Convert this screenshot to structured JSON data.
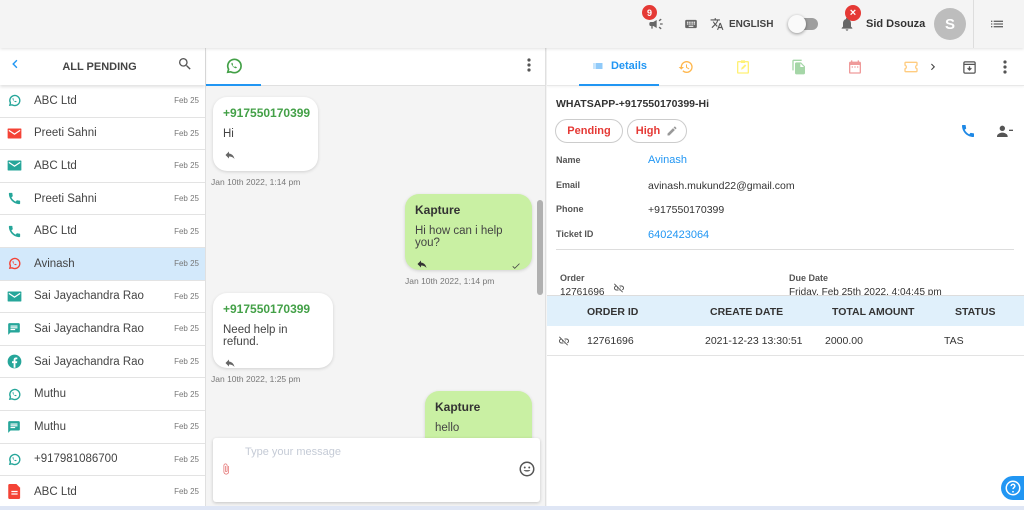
{
  "topbar": {
    "announcement_badge": "9",
    "language": "ENGLISH",
    "toggle_on": false,
    "notification_badge": "×",
    "user_name": "Sid Dsouza",
    "avatar_initial": "S"
  },
  "left_panel": {
    "title": "ALL PENDING",
    "items": [
      {
        "channel": "whatsapp",
        "name": "ABC Ltd",
        "date": "Feb 25",
        "icon_color": "#26a69a"
      },
      {
        "channel": "email",
        "name": "Preeti Sahni",
        "date": "Feb 25",
        "icon_color": "#f44336"
      },
      {
        "channel": "email",
        "name": "ABC Ltd",
        "date": "Feb 25",
        "icon_color": "#26a69a"
      },
      {
        "channel": "phone",
        "name": "Preeti Sahni",
        "date": "Feb 25",
        "icon_color": "#26a69a"
      },
      {
        "channel": "phone",
        "name": "ABC Ltd",
        "date": "Feb 25",
        "icon_color": "#26a69a"
      },
      {
        "channel": "whatsapp",
        "name": "Avinash",
        "date": "Feb 25",
        "icon_color": "#f44336",
        "active": true
      },
      {
        "channel": "email",
        "name": "Sai Jayachandra Rao",
        "date": "Feb 25",
        "icon_color": "#26a69a"
      },
      {
        "channel": "chat",
        "name": "Sai Jayachandra Rao",
        "date": "Feb 25",
        "icon_color": "#26a69a"
      },
      {
        "channel": "facebook",
        "name": "Sai Jayachandra Rao",
        "date": "Feb 25",
        "icon_color": "#26a69a"
      },
      {
        "channel": "whatsapp",
        "name": "Muthu",
        "date": "Feb 25",
        "icon_color": "#26a69a"
      },
      {
        "channel": "chat",
        "name": "Muthu",
        "date": "Feb 25",
        "icon_color": "#26a69a"
      },
      {
        "channel": "whatsapp",
        "name": "+917981086700",
        "date": "Feb 25",
        "icon_color": "#26a69a"
      },
      {
        "channel": "document",
        "name": "ABC Ltd",
        "date": "Feb 25",
        "icon_color": "#f44336"
      }
    ]
  },
  "chat": {
    "messages": [
      {
        "direction": "in",
        "sender": "+917550170399",
        "text": "Hi",
        "time": "Jan 10th 2022, 1:14 pm"
      },
      {
        "direction": "out",
        "sender": "Kapture",
        "text": "Hi how can i help you?",
        "time": "Jan 10th 2022, 1:14 pm"
      },
      {
        "direction": "in",
        "sender": "+917550170399",
        "text": "Need help in refund.",
        "time": "Jan 10th 2022, 1:25 pm"
      },
      {
        "direction": "out",
        "sender": "Kapture",
        "text": "hello",
        "time": ""
      }
    ],
    "composer_placeholder": "Type your message",
    "composer_value": ""
  },
  "details": {
    "tab_label": "Details",
    "ticket_title": "WHATSAPP-+917550170399-Hi",
    "status": "Pending",
    "priority": "High",
    "fields": [
      {
        "label": "Name",
        "value": "Avinash"
      },
      {
        "label": "Email",
        "value": "avinash.mukund22@gmail.com"
      },
      {
        "label": "Phone",
        "value": "+917550170399"
      },
      {
        "label": "Ticket ID",
        "value": "6402423064"
      }
    ],
    "order_label": "Order",
    "order_value": "12761696",
    "due_date_label": "Due Date",
    "due_date_value": "Friday, Feb 25th 2022, 4:04:45 pm",
    "table": {
      "headers": [
        "ORDER ID",
        "CREATE DATE",
        "TOTAL AMOUNT",
        "STATUS"
      ],
      "rows": [
        [
          "12761696",
          "2021-12-23 13:30:51",
          "2000.00",
          "TAS"
        ]
      ]
    }
  },
  "colors": {
    "accent": "#2196f3",
    "whatsapp_green": "#43a047",
    "outgoing_bubble": "#c9f0a3",
    "alert_red": "#e53935",
    "selected_row": "#d3e9fb"
  }
}
